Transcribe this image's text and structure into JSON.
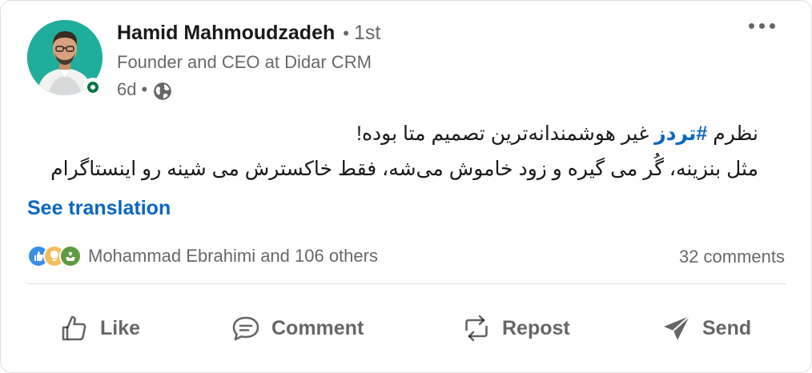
{
  "post": {
    "author": {
      "name": "Hamid Mahmoudzadeh",
      "separator": "•",
      "degree": "1st",
      "headline": "Founder and CEO at Didar CRM",
      "time": "6d",
      "meta_separator": "•",
      "visibility_icon": "globe-icon",
      "online_status": "online"
    },
    "text": {
      "line1_prefix": "نظرم ",
      "hashtag": "#تردز",
      "line1_suffix": " غیر هوشمندانه‌ترین تصمیم متا بوده!",
      "line2": "مثل بنزینه، گُر می گیره و زود خاموش می‌شه، فقط خاکسترش می شینه رو اینستاگرام"
    },
    "see_translation": "See translation",
    "reactions": {
      "icons": [
        "like-icon",
        "insightful-icon",
        "support-icon"
      ],
      "summary": "Mohammad Ebrahimi and 106 others"
    },
    "comments_count": "32 comments",
    "actions": {
      "like": "Like",
      "comment": "Comment",
      "repost": "Repost",
      "send": "Send"
    }
  },
  "colors": {
    "accent": "#0a66c2",
    "online": "#057642",
    "avatar_bg": "#1fae9b",
    "muted_text": "#00000099"
  }
}
